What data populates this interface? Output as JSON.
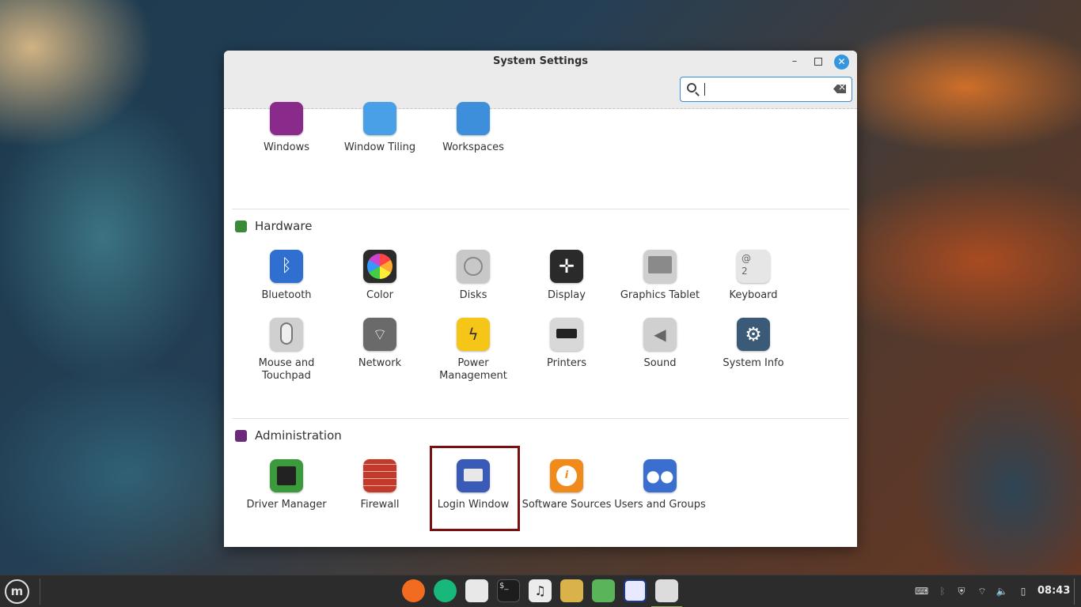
{
  "window": {
    "title": "System Settings",
    "search": {
      "value": "",
      "placeholder": ""
    }
  },
  "top_row": [
    {
      "label": "Windows",
      "icon": "windows-icon",
      "color": "#8a2a8a"
    },
    {
      "label": "Window Tiling",
      "icon": "window-tiling-icon",
      "color": "#4aa0e6"
    },
    {
      "label": "Workspaces",
      "icon": "workspaces-icon",
      "color": "#3d8fdc"
    }
  ],
  "sections": {
    "hardware": {
      "title": "Hardware",
      "color": "#3a8a3a",
      "items": [
        {
          "label": "Bluetooth",
          "icon": "bluetooth-icon",
          "color": "#2f6fd0"
        },
        {
          "label": "Color",
          "icon": "color-icon",
          "color": "#2b2b2b"
        },
        {
          "label": "Disks",
          "icon": "disks-icon",
          "color": "#c8c8c8"
        },
        {
          "label": "Display",
          "icon": "display-icon",
          "color": "#2a2a2a"
        },
        {
          "label": "Graphics Tablet",
          "icon": "graphics-tablet-icon",
          "color": "#cfcfcf"
        },
        {
          "label": "Keyboard",
          "icon": "keyboard-icon",
          "color": "#e6e6e6"
        },
        {
          "label": "Mouse and Touchpad",
          "icon": "mouse-icon",
          "color": "#d0d0d0"
        },
        {
          "label": "Network",
          "icon": "network-icon",
          "color": "#6a6a6a"
        },
        {
          "label": "Power Management",
          "icon": "power-icon",
          "color": "#f5c518"
        },
        {
          "label": "Printers",
          "icon": "printer-icon",
          "color": "#d8d8d8"
        },
        {
          "label": "Sound",
          "icon": "sound-icon",
          "color": "#d0d0d0"
        },
        {
          "label": "System Info",
          "icon": "system-info-icon",
          "color": "#3a5a78"
        }
      ]
    },
    "administration": {
      "title": "Administration",
      "color": "#6b2a7a",
      "items": [
        {
          "label": "Driver Manager",
          "icon": "driver-manager-icon",
          "color": "#3b9a3b"
        },
        {
          "label": "Firewall",
          "icon": "firewall-icon",
          "color": "#c43a2a"
        },
        {
          "label": "Login Window",
          "icon": "login-window-icon",
          "color": "#3a5ab8"
        },
        {
          "label": "Software Sources",
          "icon": "software-sources-icon",
          "color": "#f08a1a"
        },
        {
          "label": "Users and Groups",
          "icon": "users-groups-icon",
          "color": "#3a6fd0"
        }
      ]
    }
  },
  "taskbar": {
    "menu_icon": "m",
    "apps": [
      {
        "name": "firefox-icon",
        "color": "#f36b20"
      },
      {
        "name": "element-icon",
        "color": "#18b87a"
      },
      {
        "name": "tasks-icon",
        "color": "#e8e8e8"
      },
      {
        "name": "terminal-icon",
        "color": "#1d1d1d"
      },
      {
        "name": "music-icon",
        "color": "#ececec"
      },
      {
        "name": "files-icon",
        "color": "#d9b24a"
      },
      {
        "name": "keys-icon",
        "color": "#5ab55a"
      },
      {
        "name": "bitwarden-icon",
        "color": "#e8e8ff"
      },
      {
        "name": "settings-icon",
        "color": "#dcdcdc"
      }
    ],
    "clock": "08:43"
  }
}
